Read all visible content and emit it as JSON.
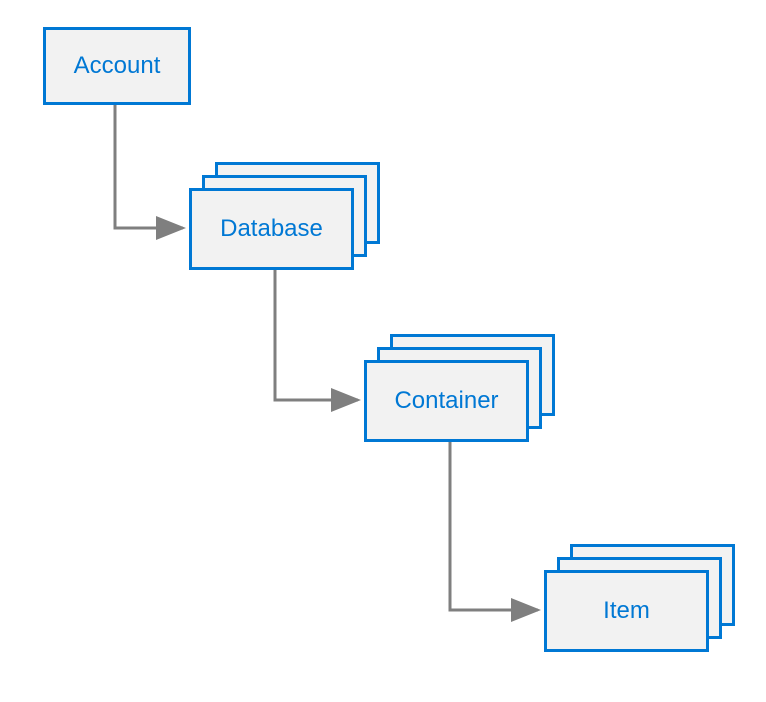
{
  "diagram": {
    "nodes": {
      "account": {
        "label": "Account"
      },
      "database": {
        "label": "Database"
      },
      "container": {
        "label": "Container"
      },
      "item": {
        "label": "Item"
      }
    },
    "colors": {
      "border": "#0078D4",
      "text": "#0078D4",
      "fill": "#f2f2f2",
      "connector": "#7f7f7f"
    },
    "hierarchy": [
      "Account",
      "Database",
      "Container",
      "Item"
    ]
  }
}
